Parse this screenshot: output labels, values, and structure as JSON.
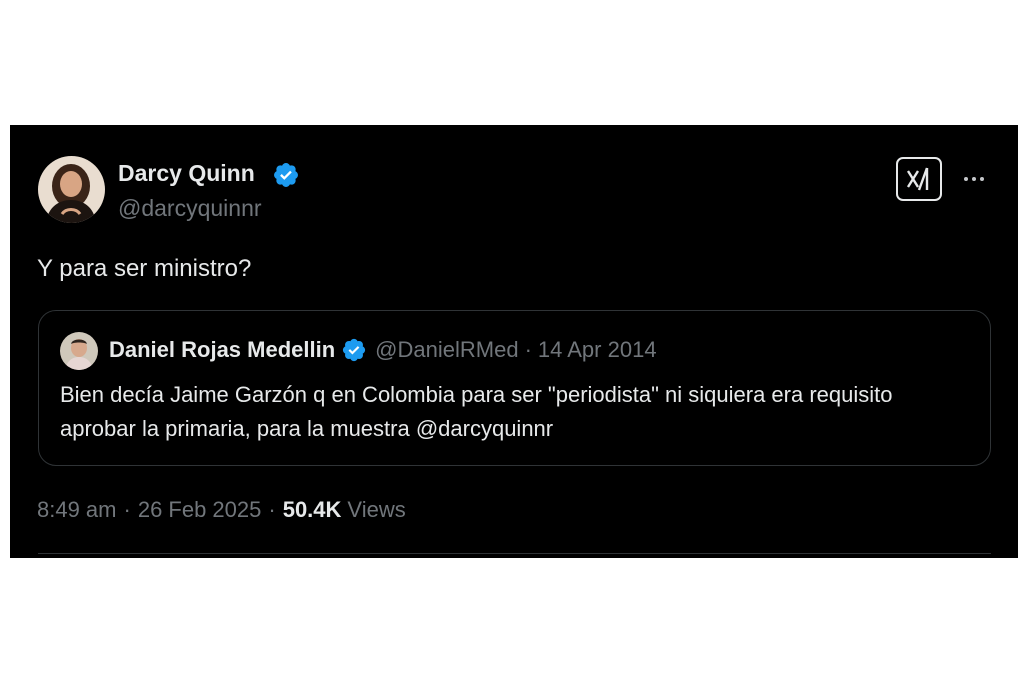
{
  "tweet": {
    "author": {
      "name": "Darcy Quinn",
      "handle": "@darcyquinnr",
      "verified": true
    },
    "text": "Y para ser ministro?",
    "quote": {
      "author_name": "Daniel Rojas Medellin",
      "author_handle": "@DanielRMed",
      "separator": "·",
      "date": "14 Apr 2014",
      "text": "Bien decía Jaime Garzón q en Colombia para ser \"periodista\" ni siquiera era requisito aprobar la primaria, para la muestra @darcyquinnr"
    },
    "meta": {
      "time": "8:49 am",
      "separator": "·",
      "date": "26 Feb 2025",
      "views_count": "50.4K",
      "views_label": "Views"
    }
  },
  "colors": {
    "background": "#000000",
    "text": "#e7e9ea",
    "secondary_text": "#71767b",
    "verified_blue": "#1d9bf0",
    "border": "#2f3336"
  },
  "icons": {
    "verified": "verified-badge-icon",
    "grok": "grok-icon",
    "more": "more-horizontal-icon"
  }
}
